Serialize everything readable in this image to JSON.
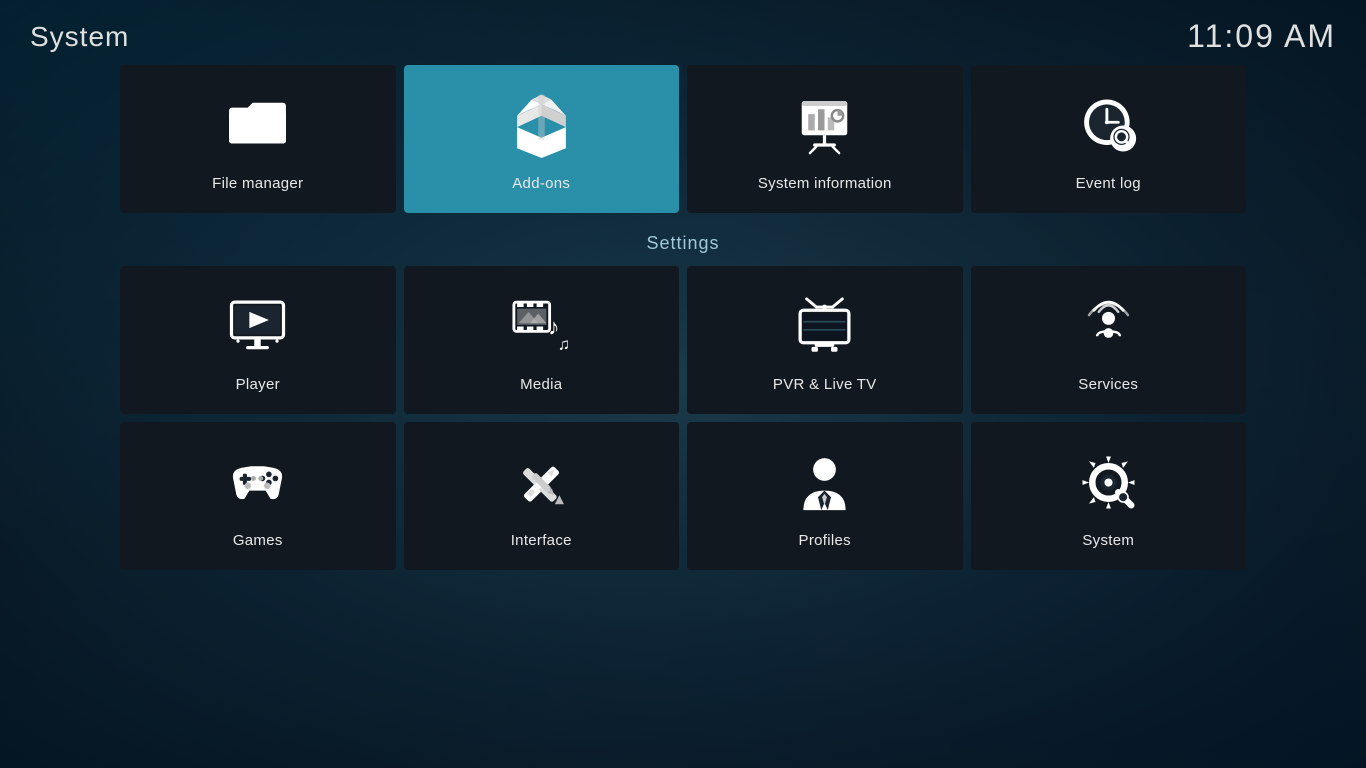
{
  "header": {
    "title": "System",
    "time": "11:09 AM"
  },
  "top_row": [
    {
      "id": "file-manager",
      "label": "File manager",
      "icon": "folder"
    },
    {
      "id": "add-ons",
      "label": "Add-ons",
      "icon": "addons",
      "active": true
    },
    {
      "id": "system-information",
      "label": "System information",
      "icon": "system-info"
    },
    {
      "id": "event-log",
      "label": "Event log",
      "icon": "event-log"
    }
  ],
  "settings_label": "Settings",
  "settings_row1": [
    {
      "id": "player",
      "label": "Player",
      "icon": "player"
    },
    {
      "id": "media",
      "label": "Media",
      "icon": "media"
    },
    {
      "id": "pvr-live-tv",
      "label": "PVR & Live TV",
      "icon": "pvr"
    },
    {
      "id": "services",
      "label": "Services",
      "icon": "services"
    }
  ],
  "settings_row2": [
    {
      "id": "games",
      "label": "Games",
      "icon": "games"
    },
    {
      "id": "interface",
      "label": "Interface",
      "icon": "interface"
    },
    {
      "id": "profiles",
      "label": "Profiles",
      "icon": "profiles"
    },
    {
      "id": "system",
      "label": "System",
      "icon": "system"
    }
  ]
}
